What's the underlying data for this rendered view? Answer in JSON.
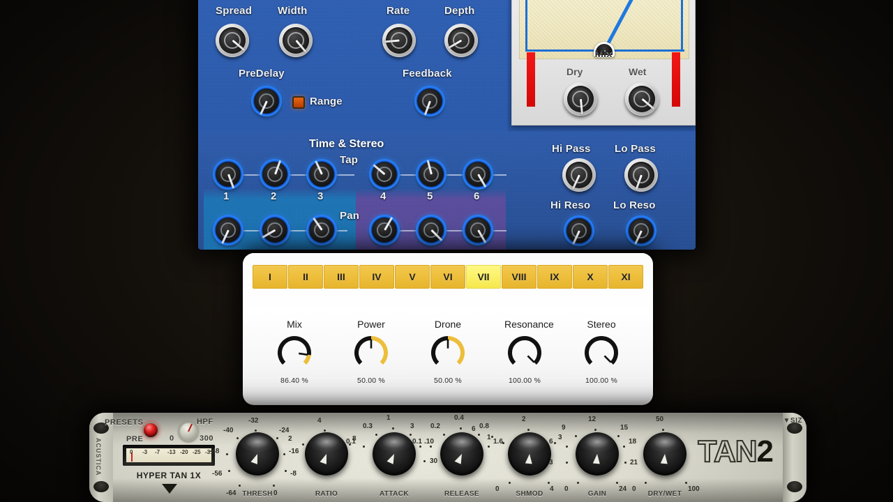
{
  "delay_plugin": {
    "modulation": {
      "knobs": [
        {
          "label": "Spread",
          "angle": 130
        },
        {
          "label": "Width",
          "angle": 140
        },
        {
          "label": "Rate",
          "angle": 265
        },
        {
          "label": "Depth",
          "angle": 240
        }
      ],
      "predelay_label": "PreDelay",
      "predelay_angle": 205,
      "range_label": "Range",
      "range_on": true,
      "range_color": "#d2560c",
      "feedback_label": "Feedback",
      "feedback_angle": 200
    },
    "time_stereo": {
      "title": "Time & Stereo",
      "tap_label": "Tap",
      "pan_label": "Pan",
      "tap_numbers": [
        "1",
        "2",
        "3",
        "4",
        "5",
        "6"
      ],
      "tap_angles": [
        160,
        20,
        335,
        310,
        345,
        150
      ],
      "pan_angles": [
        205,
        240,
        325,
        30,
        135,
        150
      ],
      "tint_left_color": "#00bee8",
      "tint_right_color": "#d73ca0"
    },
    "filters": [
      {
        "label": "Hi Pass",
        "angle": 205
      },
      {
        "label": "Lo Pass",
        "angle": 200
      },
      {
        "label": "Hi Reso",
        "angle": 205
      },
      {
        "label": "Lo Reso",
        "angle": 205
      }
    ],
    "mix": {
      "title": "Mix",
      "dry_label": "Dry",
      "wet_label": "Wet",
      "dry_angle": 175,
      "wet_angle": 130,
      "meter_color": "#ec1212",
      "needle_angle": 28,
      "needle_color": "#1f78e0"
    }
  },
  "tab_plugin": {
    "tabs": [
      {
        "label": "I",
        "active": false
      },
      {
        "label": "II",
        "active": false
      },
      {
        "label": "III",
        "active": false
      },
      {
        "label": "IV",
        "active": false
      },
      {
        "label": "V",
        "active": false
      },
      {
        "label": "VI",
        "active": false
      },
      {
        "label": "VII",
        "active": true
      },
      {
        "label": "VIII",
        "active": false
      },
      {
        "label": "IX",
        "active": false
      },
      {
        "label": "X",
        "active": false
      },
      {
        "label": "XI",
        "active": false
      }
    ],
    "accent_color": "#edbe3b",
    "active_color": "#fbf169",
    "knobs": [
      {
        "name": "Mix",
        "value": "86.40 %",
        "pct": 86.4
      },
      {
        "name": "Power",
        "value": "50.00 %",
        "pct": 50.0
      },
      {
        "name": "Drone",
        "value": "50.00 %",
        "pct": 50.0
      },
      {
        "name": "Resonance",
        "value": "100.00 %",
        "pct": 100.0
      },
      {
        "name": "Stereo",
        "value": "100.00 %",
        "pct": 100.0
      }
    ]
  },
  "tan2": {
    "brand": "ACUSTICA",
    "presets_label": "PRESETS",
    "pre_label": "PRE",
    "hpf_label": "HPF",
    "hpf_min": "0",
    "hpf_max": "300",
    "meter_scale": [
      "0",
      "-3",
      "-7",
      "-13",
      "-20",
      "-25",
      "-31"
    ],
    "model_label": "HYPER TAN 1X",
    "logo_hollow": "TAN",
    "logo_solid": "2",
    "size_label": "▼SIZ",
    "knobs": [
      {
        "label": "THRESH",
        "ticks": [
          "-40",
          "-32",
          "-24",
          "-48",
          "-16",
          "-56",
          "-8",
          "-64",
          "0"
        ],
        "angle": 200
      },
      {
        "label": "RATIO",
        "ticks": [
          "4",
          "2",
          "8"
        ],
        "angle": 200
      },
      {
        "label": "ATTACK",
        "ticks": [
          "0.3",
          "1",
          "3",
          "0.1",
          ".10",
          "30"
        ],
        "angle": 205
      },
      {
        "label": "RELEASE",
        "ticks": [
          "0.2",
          "0.4",
          "0.8",
          "0.1",
          "1.6"
        ],
        "angle": 205
      },
      {
        "label": "SHMOD",
        "ticks": [
          "2",
          "1",
          "3",
          "6",
          "0",
          "4"
        ],
        "angle": 185
      },
      {
        "label": "GAIN",
        "ticks": [
          "12",
          "9",
          "15",
          "6",
          "18",
          "3",
          "21",
          "0",
          "24"
        ],
        "angle": 185
      },
      {
        "label": "DRY/WET",
        "ticks": [
          "50",
          "0",
          "100"
        ],
        "angle": 185
      }
    ]
  }
}
